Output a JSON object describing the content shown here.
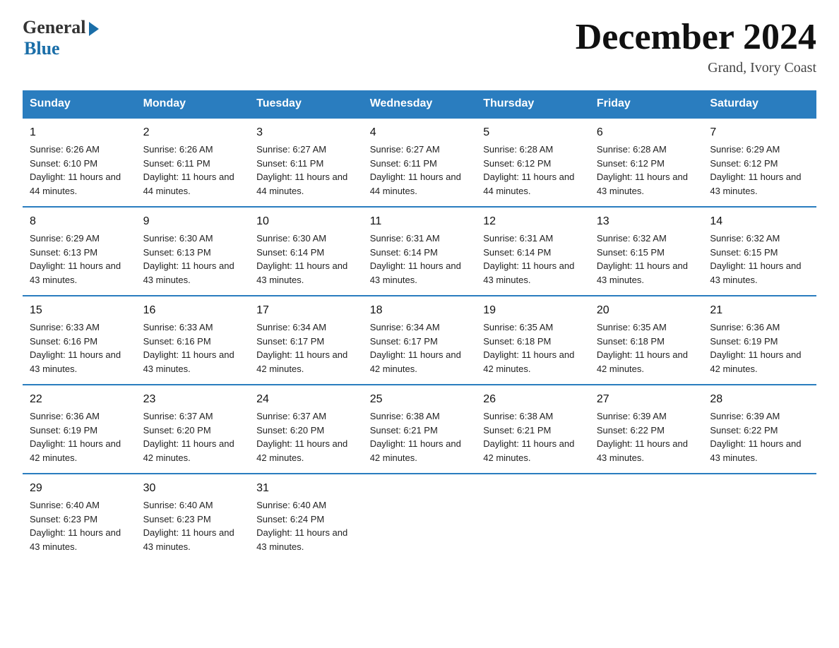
{
  "logo": {
    "general": "General",
    "blue": "Blue"
  },
  "title": "December 2024",
  "location": "Grand, Ivory Coast",
  "days_of_week": [
    "Sunday",
    "Monday",
    "Tuesday",
    "Wednesday",
    "Thursday",
    "Friday",
    "Saturday"
  ],
  "weeks": [
    [
      {
        "day": "1",
        "sunrise": "6:26 AM",
        "sunset": "6:10 PM",
        "daylight": "11 hours and 44 minutes."
      },
      {
        "day": "2",
        "sunrise": "6:26 AM",
        "sunset": "6:11 PM",
        "daylight": "11 hours and 44 minutes."
      },
      {
        "day": "3",
        "sunrise": "6:27 AM",
        "sunset": "6:11 PM",
        "daylight": "11 hours and 44 minutes."
      },
      {
        "day": "4",
        "sunrise": "6:27 AM",
        "sunset": "6:11 PM",
        "daylight": "11 hours and 44 minutes."
      },
      {
        "day": "5",
        "sunrise": "6:28 AM",
        "sunset": "6:12 PM",
        "daylight": "11 hours and 44 minutes."
      },
      {
        "day": "6",
        "sunrise": "6:28 AM",
        "sunset": "6:12 PM",
        "daylight": "11 hours and 43 minutes."
      },
      {
        "day": "7",
        "sunrise": "6:29 AM",
        "sunset": "6:12 PM",
        "daylight": "11 hours and 43 minutes."
      }
    ],
    [
      {
        "day": "8",
        "sunrise": "6:29 AM",
        "sunset": "6:13 PM",
        "daylight": "11 hours and 43 minutes."
      },
      {
        "day": "9",
        "sunrise": "6:30 AM",
        "sunset": "6:13 PM",
        "daylight": "11 hours and 43 minutes."
      },
      {
        "day": "10",
        "sunrise": "6:30 AM",
        "sunset": "6:14 PM",
        "daylight": "11 hours and 43 minutes."
      },
      {
        "day": "11",
        "sunrise": "6:31 AM",
        "sunset": "6:14 PM",
        "daylight": "11 hours and 43 minutes."
      },
      {
        "day": "12",
        "sunrise": "6:31 AM",
        "sunset": "6:14 PM",
        "daylight": "11 hours and 43 minutes."
      },
      {
        "day": "13",
        "sunrise": "6:32 AM",
        "sunset": "6:15 PM",
        "daylight": "11 hours and 43 minutes."
      },
      {
        "day": "14",
        "sunrise": "6:32 AM",
        "sunset": "6:15 PM",
        "daylight": "11 hours and 43 minutes."
      }
    ],
    [
      {
        "day": "15",
        "sunrise": "6:33 AM",
        "sunset": "6:16 PM",
        "daylight": "11 hours and 43 minutes."
      },
      {
        "day": "16",
        "sunrise": "6:33 AM",
        "sunset": "6:16 PM",
        "daylight": "11 hours and 43 minutes."
      },
      {
        "day": "17",
        "sunrise": "6:34 AM",
        "sunset": "6:17 PM",
        "daylight": "11 hours and 42 minutes."
      },
      {
        "day": "18",
        "sunrise": "6:34 AM",
        "sunset": "6:17 PM",
        "daylight": "11 hours and 42 minutes."
      },
      {
        "day": "19",
        "sunrise": "6:35 AM",
        "sunset": "6:18 PM",
        "daylight": "11 hours and 42 minutes."
      },
      {
        "day": "20",
        "sunrise": "6:35 AM",
        "sunset": "6:18 PM",
        "daylight": "11 hours and 42 minutes."
      },
      {
        "day": "21",
        "sunrise": "6:36 AM",
        "sunset": "6:19 PM",
        "daylight": "11 hours and 42 minutes."
      }
    ],
    [
      {
        "day": "22",
        "sunrise": "6:36 AM",
        "sunset": "6:19 PM",
        "daylight": "11 hours and 42 minutes."
      },
      {
        "day": "23",
        "sunrise": "6:37 AM",
        "sunset": "6:20 PM",
        "daylight": "11 hours and 42 minutes."
      },
      {
        "day": "24",
        "sunrise": "6:37 AM",
        "sunset": "6:20 PM",
        "daylight": "11 hours and 42 minutes."
      },
      {
        "day": "25",
        "sunrise": "6:38 AM",
        "sunset": "6:21 PM",
        "daylight": "11 hours and 42 minutes."
      },
      {
        "day": "26",
        "sunrise": "6:38 AM",
        "sunset": "6:21 PM",
        "daylight": "11 hours and 42 minutes."
      },
      {
        "day": "27",
        "sunrise": "6:39 AM",
        "sunset": "6:22 PM",
        "daylight": "11 hours and 43 minutes."
      },
      {
        "day": "28",
        "sunrise": "6:39 AM",
        "sunset": "6:22 PM",
        "daylight": "11 hours and 43 minutes."
      }
    ],
    [
      {
        "day": "29",
        "sunrise": "6:40 AM",
        "sunset": "6:23 PM",
        "daylight": "11 hours and 43 minutes."
      },
      {
        "day": "30",
        "sunrise": "6:40 AM",
        "sunset": "6:23 PM",
        "daylight": "11 hours and 43 minutes."
      },
      {
        "day": "31",
        "sunrise": "6:40 AM",
        "sunset": "6:24 PM",
        "daylight": "11 hours and 43 minutes."
      },
      null,
      null,
      null,
      null
    ]
  ]
}
